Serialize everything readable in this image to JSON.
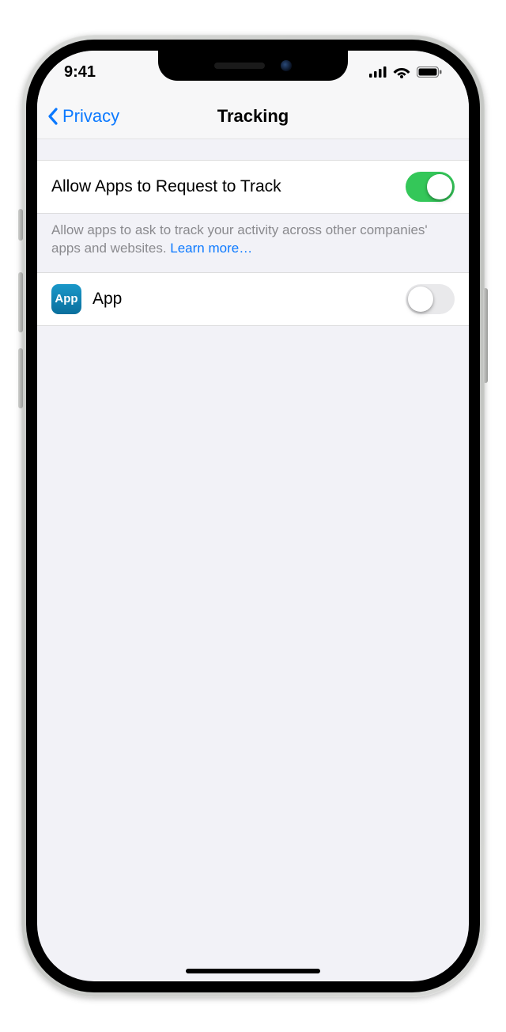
{
  "statusbar": {
    "time": "9:41"
  },
  "nav": {
    "back_label": "Privacy",
    "title": "Tracking"
  },
  "allow_tracking": {
    "label": "Allow Apps to Request to Track",
    "enabled": true
  },
  "footer": {
    "text": "Allow apps to ask to track your activity across other companies' apps and websites. ",
    "link_text": "Learn more…"
  },
  "apps": [
    {
      "icon_text": "App",
      "name": "App",
      "tracking_enabled": false
    }
  ]
}
